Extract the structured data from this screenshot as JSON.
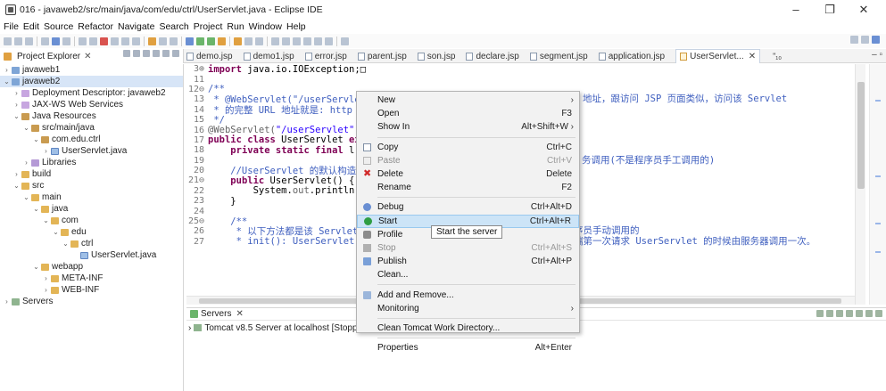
{
  "window": {
    "title": "016 - javaweb2/src/main/java/com/edu/ctrl/UserServlet.java - Eclipse IDE",
    "controls": [
      "–",
      "❐",
      "✕"
    ]
  },
  "menubar": [
    "File",
    "Edit",
    "Source",
    "Refactor",
    "Navigate",
    "Search",
    "Project",
    "Run",
    "Window",
    "Help"
  ],
  "project_explorer": {
    "tab_label": "Project Explorer",
    "tree": [
      {
        "label": "javaweb1",
        "twisty": "›",
        "icon": "proj",
        "indent": 0
      },
      {
        "label": "javaweb2",
        "twisty": "⌄",
        "icon": "proj",
        "indent": 0,
        "selected": true
      },
      {
        "label": "Deployment Descriptor: javaweb2",
        "twisty": "›",
        "icon": "dd",
        "indent": 1
      },
      {
        "label": "JAX-WS Web Services",
        "twisty": "›",
        "icon": "dd",
        "indent": 1
      },
      {
        "label": "Java Resources",
        "twisty": "⌄",
        "icon": "pkg",
        "indent": 1
      },
      {
        "label": "src/main/java",
        "twisty": "⌄",
        "icon": "pkg",
        "indent": 2
      },
      {
        "label": "com.edu.ctrl",
        "twisty": "⌄",
        "icon": "pkg",
        "indent": 3
      },
      {
        "label": "UserServlet.java",
        "twisty": "›",
        "icon": "java",
        "indent": 4
      },
      {
        "label": "Libraries",
        "twisty": "›",
        "icon": "lib",
        "indent": 2
      },
      {
        "label": "build",
        "twisty": "›",
        "icon": "folder",
        "indent": 1
      },
      {
        "label": "src",
        "twisty": "⌄",
        "icon": "folder",
        "indent": 1
      },
      {
        "label": "main",
        "twisty": "⌄",
        "icon": "folder",
        "indent": 2
      },
      {
        "label": "java",
        "twisty": "⌄",
        "icon": "folder",
        "indent": 3
      },
      {
        "label": "com",
        "twisty": "⌄",
        "icon": "folder",
        "indent": 4
      },
      {
        "label": "edu",
        "twisty": "⌄",
        "icon": "folder",
        "indent": 5
      },
      {
        "label": "ctrl",
        "twisty": "⌄",
        "icon": "folder",
        "indent": 6
      },
      {
        "label": "UserServlet.java",
        "twisty": "",
        "icon": "java",
        "indent": 7
      },
      {
        "label": "webapp",
        "twisty": "⌄",
        "icon": "folder",
        "indent": 3
      },
      {
        "label": "META-INF",
        "twisty": "›",
        "icon": "folder",
        "indent": 4
      },
      {
        "label": "WEB-INF",
        "twisty": "›",
        "icon": "folder",
        "indent": 4
      },
      {
        "label": "Servers",
        "twisty": "›",
        "icon": "srv",
        "indent": 0
      }
    ]
  },
  "editor_tabs": [
    {
      "label": "demo.jsp",
      "active": false
    },
    {
      "label": "demo1.jsp",
      "active": false
    },
    {
      "label": "error.jsp",
      "active": false
    },
    {
      "label": "parent.jsp",
      "active": false
    },
    {
      "label": "son.jsp",
      "active": false
    },
    {
      "label": "declare.jsp",
      "active": false
    },
    {
      "label": "segment.jsp",
      "active": false
    },
    {
      "label": "application.jsp",
      "active": false
    },
    {
      "label": "UserServlet...",
      "active": true
    }
  ],
  "editor_more_tabs": "\"₁₀",
  "code_lines": [
    {
      "n": "3⊕",
      "segs": [
        [
          "kw",
          "import"
        ],
        [
          "code",
          " java.io.IOException;"
        ],
        [
          "code",
          "□"
        ]
      ]
    },
    {
      "n": "11",
      "segs": []
    },
    {
      "n": "12⊖",
      "segs": [
        [
          "cm",
          "/**"
        ]
      ]
    },
    {
      "n": "13",
      "segs": [
        [
          "cm",
          " * @WebServlet(\"/userServle"
        ]
      ]
    },
    {
      "n": "14",
      "segs": [
        [
          "cm",
          " * 的完整 URL 地址就是: http"
        ]
      ]
    },
    {
      "n": "15",
      "segs": [
        [
          "cm",
          " */"
        ]
      ]
    },
    {
      "n": "16",
      "segs": [
        [
          "an",
          "@WebServlet("
        ],
        [
          "st",
          "\"/userServlet\""
        ],
        [
          "an",
          ")"
        ]
      ]
    },
    {
      "n": "17",
      "segs": [
        [
          "kw",
          "public class"
        ],
        [
          "code",
          " UserServlet "
        ],
        [
          "kw",
          "ex"
        ]
      ]
    },
    {
      "n": "18",
      "segs": [
        [
          "code",
          "    "
        ],
        [
          "kw",
          "private static final"
        ],
        [
          "code",
          " l"
        ]
      ]
    },
    {
      "n": "19",
      "segs": []
    },
    {
      "n": "20",
      "segs": [
        [
          "cm",
          "    //UserServlet 的默认构造"
        ]
      ]
    },
    {
      "n": "21⊖",
      "segs": [
        [
          "code",
          "    "
        ],
        [
          "kw",
          "public"
        ],
        [
          "code",
          " UserServlet() {"
        ]
      ]
    },
    {
      "n": "22",
      "segs": [
        [
          "code",
          "        System."
        ],
        [
          "an",
          "out"
        ],
        [
          "code",
          ".println(\""
        ]
      ]
    },
    {
      "n": "23",
      "segs": [
        [
          "code",
          "    }"
        ]
      ]
    },
    {
      "n": "24",
      "segs": []
    },
    {
      "n": "25⊖",
      "segs": [
        [
          "cm",
          "    /**"
        ]
      ]
    },
    {
      "n": "26",
      "segs": [
        [
          "cm",
          "     * 以下方法都是该 Servlet"
        ]
      ]
    },
    {
      "n": "27",
      "segs": [
        [
          "cm",
          "     * init(): UserServlet"
        ]
      ]
    }
  ],
  "code_right": [
    {
      "line": 3,
      "text": "地址，跟访问 JSP 页面类似，访问该 Servlet"
    },
    {
      "line": 9,
      "text": "务调用(不是程序员手工调用的)"
    },
    {
      "line": 16,
      "text": "序员手动调用的"
    },
    {
      "line": 17,
      "text": "端第一次请求 UserServlet 的时候由服务器调用一次。"
    }
  ],
  "servers_view": {
    "tab_label": "Servers",
    "rows": [
      {
        "label": "Tomcat v8.5 Server at localhost  [Stopped, Republish]"
      }
    ]
  },
  "context_menu": {
    "items": [
      {
        "type": "item",
        "label": "New",
        "shortcut": "",
        "submenu": true,
        "icon": ""
      },
      {
        "type": "item",
        "label": "Open",
        "shortcut": "F3",
        "icon": ""
      },
      {
        "type": "item",
        "label": "Show In",
        "shortcut": "Alt+Shift+W",
        "submenu": true,
        "icon": ""
      },
      {
        "type": "sep"
      },
      {
        "type": "item",
        "label": "Copy",
        "shortcut": "Ctrl+C",
        "icon": "copy"
      },
      {
        "type": "item",
        "label": "Paste",
        "shortcut": "Ctrl+V",
        "icon": "paste",
        "disabled": true
      },
      {
        "type": "item",
        "label": "Delete",
        "shortcut": "Delete",
        "icon": "del"
      },
      {
        "type": "item",
        "label": "Rename",
        "shortcut": "F2",
        "icon": ""
      },
      {
        "type": "sep"
      },
      {
        "type": "item",
        "label": "Debug",
        "shortcut": "Ctrl+Alt+D",
        "icon": "debug"
      },
      {
        "type": "item",
        "label": "Start",
        "shortcut": "Ctrl+Alt+R",
        "icon": "start",
        "highlighted": true
      },
      {
        "type": "item",
        "label": "Profile",
        "shortcut": "",
        "icon": "profile"
      },
      {
        "type": "item",
        "label": "Stop",
        "shortcut": "Ctrl+Alt+S",
        "icon": "stop",
        "disabled": true
      },
      {
        "type": "item",
        "label": "Publish",
        "shortcut": "Ctrl+Alt+P",
        "icon": "publish"
      },
      {
        "type": "item",
        "label": "Clean...",
        "shortcut": "",
        "icon": ""
      },
      {
        "type": "sep"
      },
      {
        "type": "item",
        "label": "Add and Remove...",
        "shortcut": "",
        "icon": "addrem"
      },
      {
        "type": "item",
        "label": "Monitoring",
        "shortcut": "",
        "submenu": true,
        "icon": ""
      },
      {
        "type": "sep"
      },
      {
        "type": "item",
        "label": "Clean Tomcat Work Directory...",
        "shortcut": "",
        "icon": ""
      },
      {
        "type": "sep"
      },
      {
        "type": "item",
        "label": "Properties",
        "shortcut": "Alt+Enter",
        "icon": ""
      }
    ]
  },
  "tooltip": "Start the server"
}
